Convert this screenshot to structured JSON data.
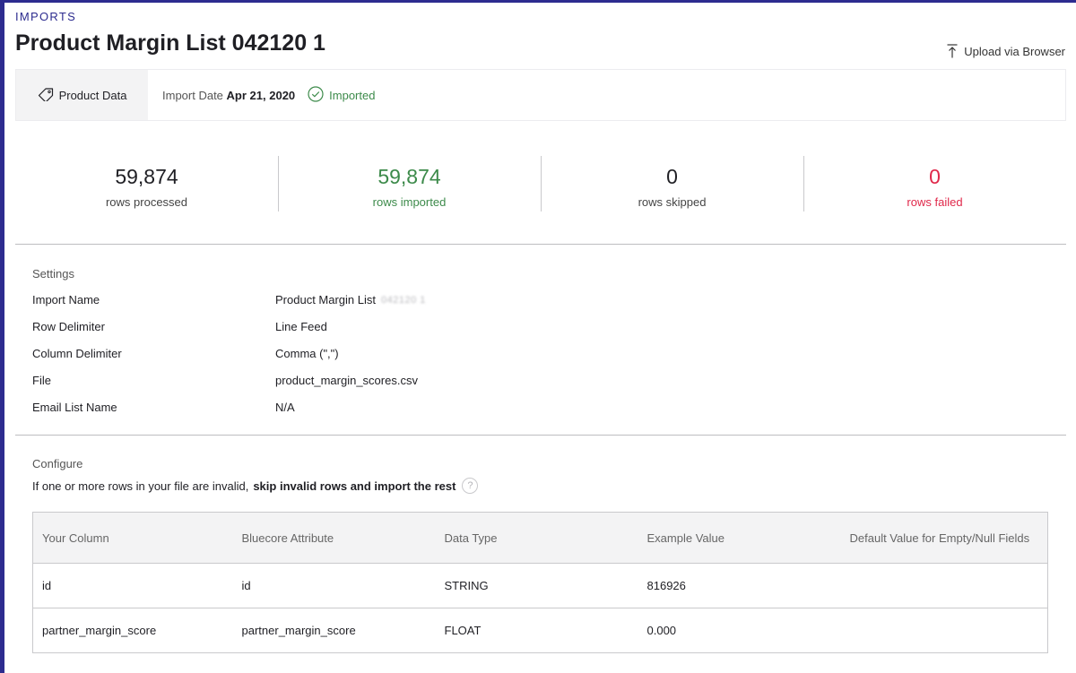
{
  "breadcrumb": "IMPORTS",
  "page_title": "Product Margin List 042120 1",
  "upload_label": "Upload via Browser",
  "info_bar": {
    "tab_label": "Product Data",
    "import_date_label": "Import Date",
    "import_date_value": "Apr 21, 2020",
    "status": "Imported"
  },
  "stats": [
    {
      "value": "59,874",
      "label": "rows processed"
    },
    {
      "value": "59,874",
      "label": "rows imported"
    },
    {
      "value": "0",
      "label": "rows skipped"
    },
    {
      "value": "0",
      "label": "rows failed"
    }
  ],
  "settings": {
    "title": "Settings",
    "rows": [
      {
        "key": "Import Name",
        "value": "Product Margin List",
        "value_suffix": "042120 1"
      },
      {
        "key": "Row Delimiter",
        "value": "Line Feed"
      },
      {
        "key": "Column Delimiter",
        "value": "Comma (\",\")"
      },
      {
        "key": "File",
        "value": "product_margin_scores.csv"
      },
      {
        "key": "Email List Name",
        "value": "N/A"
      }
    ]
  },
  "configure": {
    "title": "Configure",
    "note_prefix": "If one or more rows in your file are invalid,",
    "note_strong": "skip invalid rows and import the rest",
    "help": "?"
  },
  "table": {
    "headers": [
      "Your Column",
      "Bluecore Attribute",
      "Data Type",
      "Example Value",
      "Default Value for Empty/Null Fields"
    ],
    "rows": [
      [
        "id",
        "id",
        "STRING",
        "816926",
        ""
      ],
      [
        "partner_margin_score",
        "partner_margin_score",
        "FLOAT",
        "0.000",
        ""
      ]
    ]
  },
  "colors": {
    "accent": "#2d2c8f",
    "success": "#3c8a4a",
    "error": "#e0284a"
  },
  "icons": {
    "upload": "upload-arrow-icon",
    "tab": "tag-icon",
    "status": "check-circle-icon"
  }
}
